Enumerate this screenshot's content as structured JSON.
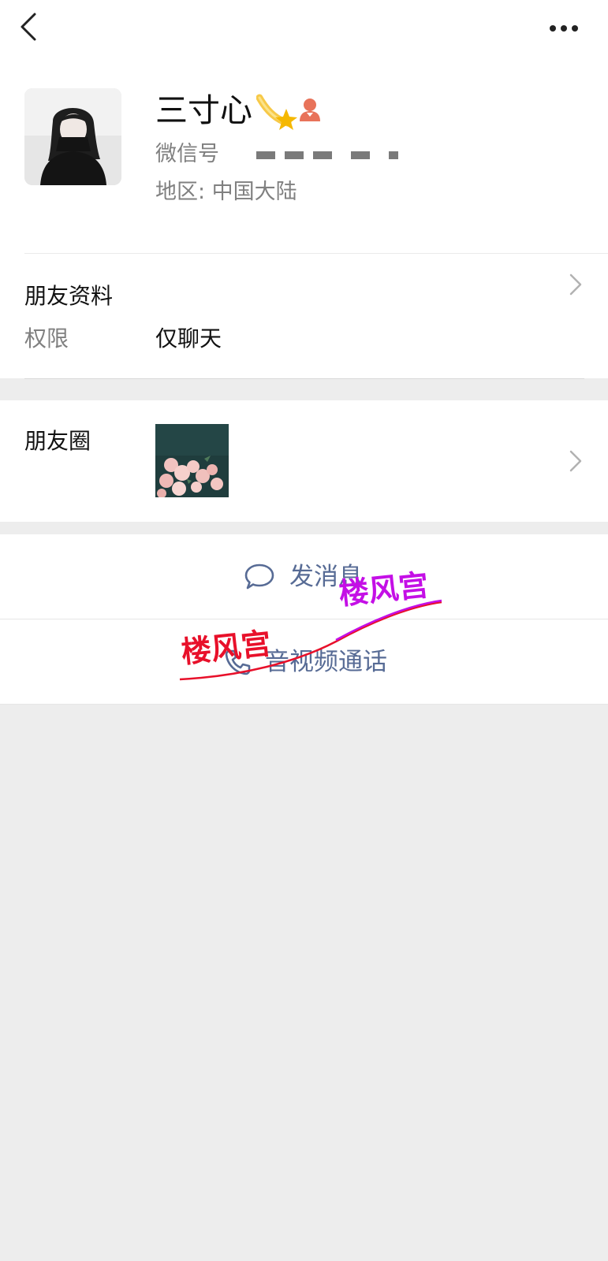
{
  "header": {
    "back_icon": "chevron-left-icon",
    "more_icon": "more-dots-icon"
  },
  "profile": {
    "name": "三寸心",
    "badge_icons": [
      "shooting-star-icon",
      "user-badge-icon"
    ],
    "wechat_id_label": "微信号",
    "region": "地区: 中国大陆"
  },
  "friend_info": {
    "title": "朋友资料",
    "permission_label": "权限",
    "permission_value": "仅聊天"
  },
  "moments": {
    "label": "朋友圈",
    "thumbnail": "pink-roses-photo"
  },
  "actions": {
    "message_label": "发消息",
    "call_label": "音视频通话"
  },
  "watermarks": [
    "楼风宫",
    "楼风宫"
  ],
  "colors": {
    "link_blue": "#576b95",
    "page_bg": "#ededed",
    "watermark_red": "#e8102a",
    "watermark_purple": "#c40fe6"
  }
}
